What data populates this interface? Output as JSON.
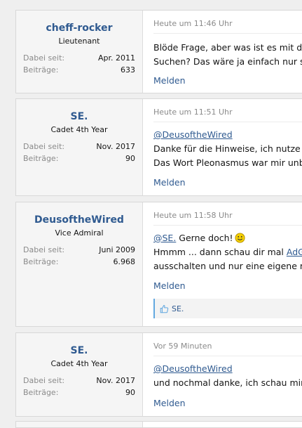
{
  "posts": [
    {
      "username": "cheff-rocker",
      "usertitle": "Lieutenant",
      "joined_label": "Dabei seit:",
      "joined": "Apr. 2011",
      "posts_label": "Beiträge:",
      "posts": "633",
      "date": "Heute um 11:46 Uhr",
      "line1": "Blöde Frage, aber was ist es mit de",
      "line2": "Suchen? Das wäre ja einfach nur so",
      "report": "Melden"
    },
    {
      "username": "SE.",
      "usertitle": "Cadet 4th Year",
      "joined_label": "Dabei seit:",
      "joined": "Nov. 2017",
      "posts_label": "Beiträge:",
      "posts": "90",
      "date": "Heute um 11:51 Uhr",
      "mention": "@DeusoftheWired",
      "line1": "Danke für die Hinweise, ich nutze i",
      "line2": "Das Wort Pleonasmus war mir unb",
      "report": "Melden"
    },
    {
      "username": "DeusoftheWired",
      "usertitle": "Vice Admiral",
      "joined_label": "Dabei seit:",
      "joined": "Juni 2009",
      "posts_label": "Beiträge:",
      "posts": "6.968",
      "date": "Heute um 11:58 Uhr",
      "mention": "@SE.",
      "mention_tail": " Gerne doch!",
      "line1_pre": "Hmmm ... dann schau dir mal ",
      "line1_link": "AdG",
      "line2": "ausschalten und nur eine eigene m",
      "report": "Melden",
      "reaction_user": "SE.",
      "reaction_icon": "thumbs-up-icon"
    },
    {
      "username": "SE.",
      "usertitle": "Cadet 4th Year",
      "joined_label": "Dabei seit:",
      "joined": "Nov. 2017",
      "posts_label": "Beiträge:",
      "posts": "90",
      "date": "Vor 59 Minuten",
      "mention": "@DeusoftheWired",
      "line1": "und nochmal danke, ich schau mir",
      "report": "Melden"
    }
  ],
  "colors": {
    "username": "#2f5a90",
    "link": "#2f5a90",
    "muted": "#8a8a8a",
    "reaction_accent": "#62a8e0",
    "smiley": "#f5d000"
  }
}
